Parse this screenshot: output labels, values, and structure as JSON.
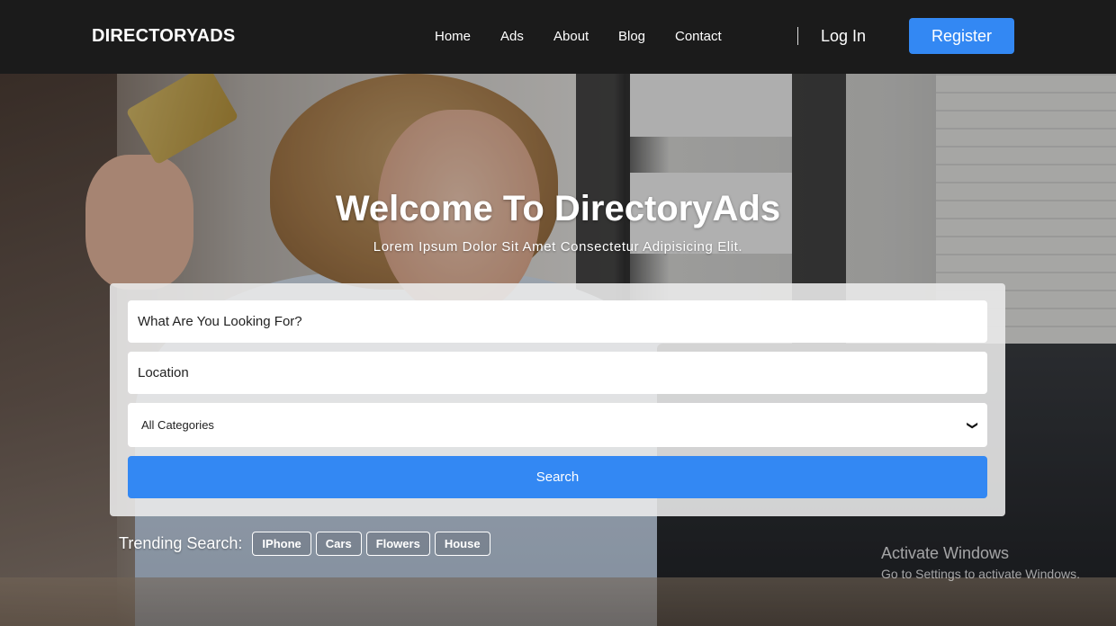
{
  "header": {
    "brand": "DIRECTORYADS",
    "nav": [
      "Home",
      "Ads",
      "About",
      "Blog",
      "Contact"
    ],
    "login_label": "Log In",
    "register_label": "Register"
  },
  "hero": {
    "title": "Welcome To DirectoryAds",
    "subtitle": "Lorem Ipsum Dolor Sit Amet Consectetur Adipisicing Elit."
  },
  "search": {
    "query_placeholder": "What Are You Looking For?",
    "location_placeholder": "Location",
    "category_selected": "All Categories",
    "button_label": "Search"
  },
  "trending": {
    "label": "Trending Search:",
    "tags": [
      "IPhone",
      "Cars",
      "Flowers",
      "House"
    ]
  },
  "watermark": {
    "title": "Activate Windows",
    "subtitle": "Go to Settings to activate Windows."
  },
  "colors": {
    "accent": "#3388f3",
    "header_bg": "#1b1b1b"
  }
}
